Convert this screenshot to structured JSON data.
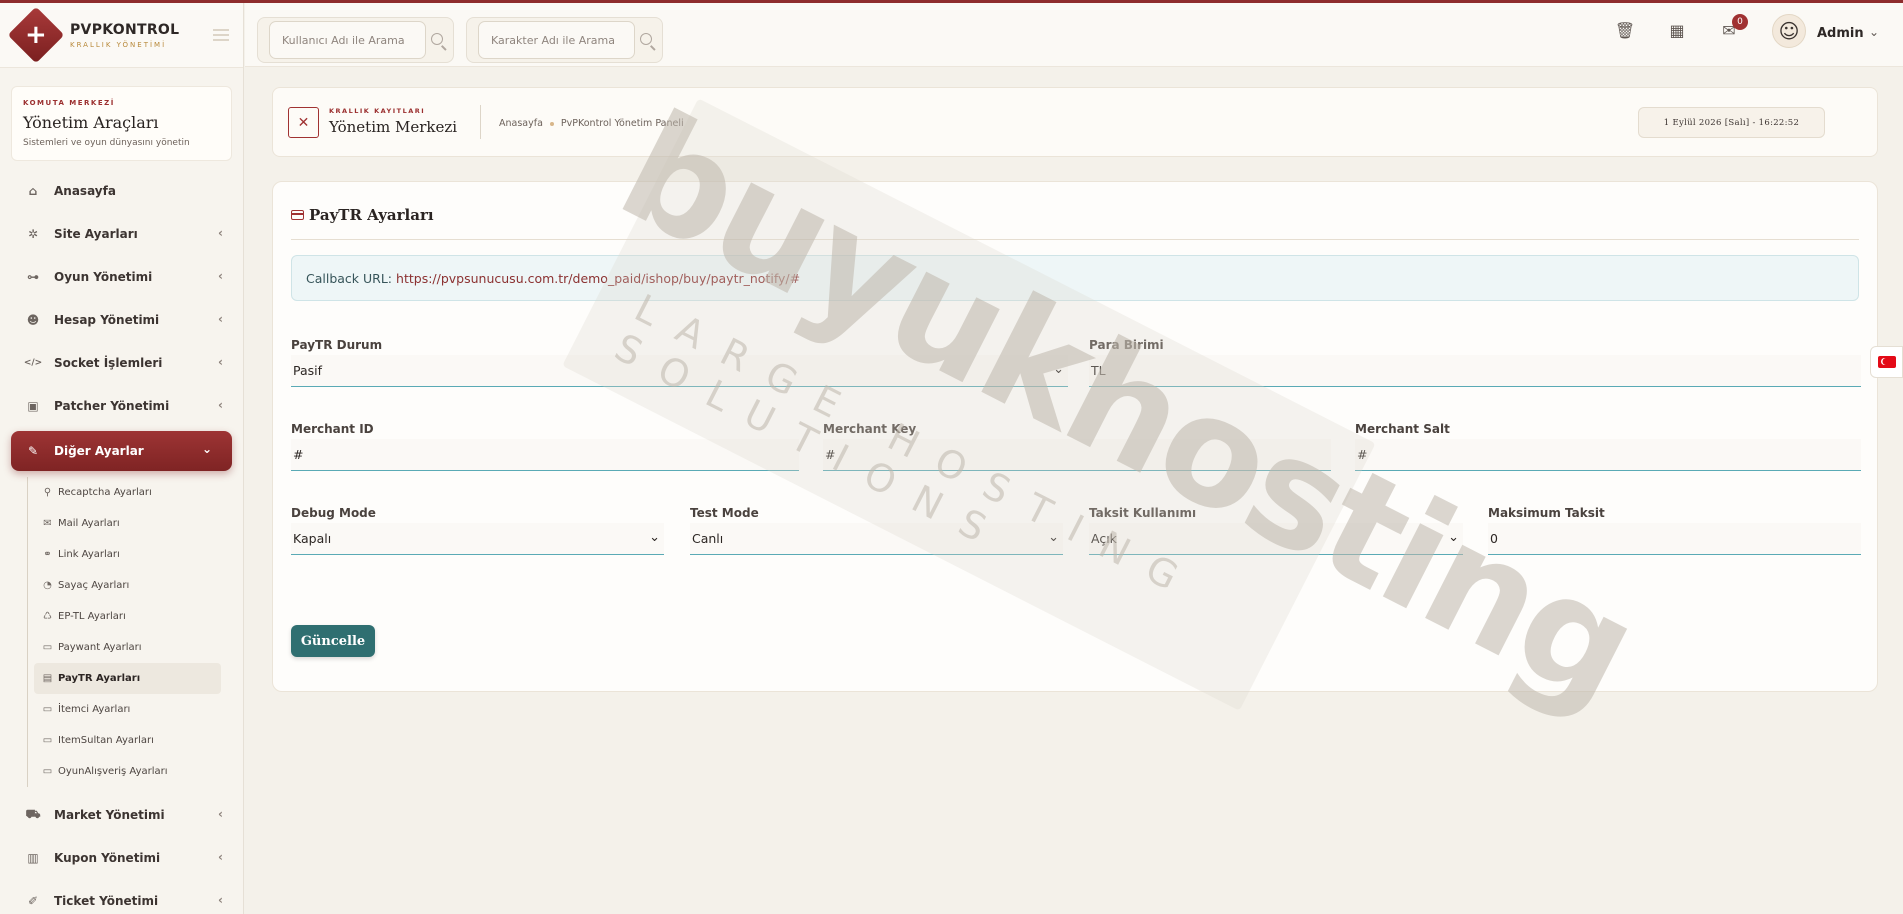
{
  "brand": {
    "title": "PVPKONTROL",
    "subtitle": "KRALLIK YÖNETİMİ",
    "logo_glyph": "+"
  },
  "sidebar": {
    "card": {
      "kicker": "KOMUTA MERKEZİ",
      "title": "Yönetim Araçları",
      "subtitle": "Sistemleri ve oyun dünyasını yönetin"
    },
    "items": [
      {
        "label": "Anasayfa",
        "icon": "home-icon",
        "glyph": "⌂"
      },
      {
        "label": "Site Ayarları",
        "icon": "gear-icon",
        "glyph": "✲"
      },
      {
        "label": "Oyun Yönetimi",
        "icon": "gamepad-icon",
        "glyph": "⊶"
      },
      {
        "label": "Hesap Yönetimi",
        "icon": "users-icon",
        "glyph": "☻"
      },
      {
        "label": "Socket İşlemleri",
        "icon": "code-icon",
        "glyph": "</>"
      },
      {
        "label": "Patcher Yönetimi",
        "icon": "box-icon",
        "glyph": "▣"
      },
      {
        "label": "Diğer Ayarlar",
        "icon": "wrench-icon",
        "glyph": "✎"
      }
    ],
    "sub_items": [
      {
        "label": "Recaptcha Ayarları",
        "glyph": "⚲"
      },
      {
        "label": "Mail Ayarları",
        "glyph": "✉"
      },
      {
        "label": "Link Ayarları",
        "glyph": "⚭"
      },
      {
        "label": "Sayaç Ayarları",
        "glyph": "◔"
      },
      {
        "label": "EP-TL Ayarları",
        "glyph": "♺"
      },
      {
        "label": "Paywant Ayarları",
        "glyph": "▭"
      },
      {
        "label": "PayTR Ayarları",
        "glyph": "▤"
      },
      {
        "label": "İtemci Ayarları",
        "glyph": "▭"
      },
      {
        "label": "ItemSultan Ayarları",
        "glyph": "▭"
      },
      {
        "label": "OyunAlışveriş Ayarları",
        "glyph": "▭"
      }
    ],
    "items_after": [
      {
        "label": "Market Yönetimi",
        "icon": "cart-icon",
        "glyph": "⛟"
      },
      {
        "label": "Kupon Yönetimi",
        "icon": "barcode-icon",
        "glyph": "▥"
      },
      {
        "label": "Ticket Yönetimi",
        "icon": "ticket-icon",
        "glyph": "✐"
      }
    ]
  },
  "topbar": {
    "search_user_placeholder": "Kullanıcı Adı ile Arama",
    "search_char_placeholder": "Karakter Adı ile Arama",
    "notification_count": "0",
    "user_name": "Admin"
  },
  "page_header": {
    "kicker": "KRALLIK KAYITLARI",
    "title": "Yönetim Merkezi",
    "breadcrumb_home": "Anasayfa",
    "breadcrumb_current": "PvPKontrol Yönetim Paneli",
    "datetime": "1 Eylül 2026 [Salı] - 16:22:52"
  },
  "card": {
    "title": "PayTR Ayarları",
    "callback_label": "Callback URL:",
    "callback_url": "https://pvpsunucusu.com.tr/demo_paid/ishop/buy/paytr_notify/#",
    "fields": {
      "paytr_status": {
        "label": "PayTR Durum",
        "value": "Pasif"
      },
      "currency": {
        "label": "Para Birimi",
        "value": "TL"
      },
      "merchant_id": {
        "label": "Merchant ID",
        "value": "#"
      },
      "merchant_key": {
        "label": "Merchant Key",
        "value": "#"
      },
      "merchant_salt": {
        "label": "Merchant Salt",
        "value": "#"
      },
      "debug_mode": {
        "label": "Debug Mode",
        "value": "Kapalı"
      },
      "test_mode": {
        "label": "Test Mode",
        "value": "Canlı"
      },
      "installment_use": {
        "label": "Taksit Kullanımı",
        "value": "Açık"
      },
      "max_installment": {
        "label": "Maksimum Taksit",
        "value": "0"
      }
    },
    "submit_label": "Güncelle"
  },
  "watermark": {
    "big": "buyukhosting",
    "small": "LARGE HOSTING SOLUTIONS"
  },
  "colors": {
    "accent_red": "#9d3434",
    "accent_teal": "#2f6f71",
    "input_underline": "#5aaab5",
    "background": "#f4f1ea"
  }
}
